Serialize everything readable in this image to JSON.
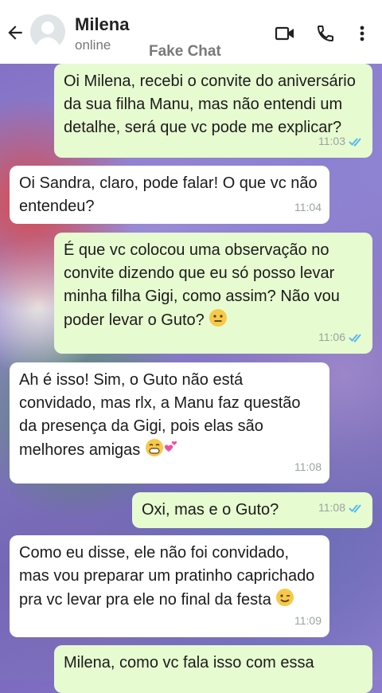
{
  "header": {
    "contact_name": "Milena",
    "status": "online",
    "watermark": "Fake Chat",
    "icons": [
      "back-arrow-icon",
      "avatar",
      "video-call-icon",
      "phone-call-icon",
      "more-options-icon"
    ]
  },
  "colors": {
    "incoming_bubble": "#ffffff",
    "outgoing_bubble": "#e6fbd0",
    "read_ticks": "#4fb6ec"
  },
  "messages": [
    {
      "direction": "out",
      "text": "Oi Milena, recebi o convite do aniversário da sua filha Manu, mas não entendi um detalhe, será que vc pode me explicar?",
      "time": "11:03",
      "read": true
    },
    {
      "direction": "in",
      "text": "Oi Sandra, claro, pode falar! O que vc não entendeu?",
      "time": "11:04"
    },
    {
      "direction": "out",
      "text": "É que vc colocou uma observação no convite dizendo que eu só posso levar minha filha Gigi, como assim? Não vou poder levar o Guto?",
      "emoji": "neutral-face-emoji",
      "time": "11:06",
      "read": true
    },
    {
      "direction": "in",
      "text": "Ah é isso! Sim, o Guto não está convidado, mas rlx, a Manu faz questão da presença da Gigi, pois elas são melhores amigas",
      "emoji": "grin-hearts-emoji",
      "time": "11:08"
    },
    {
      "direction": "out",
      "text": "Oxi, mas e o Guto?",
      "time": "11:08",
      "read": true
    },
    {
      "direction": "in",
      "text": "Como eu disse, ele não foi convidado, mas vou preparar um pratinho caprichado pra vc levar pra ele no final da festa",
      "emoji": "wink-emoji",
      "time": "11:09"
    },
    {
      "direction": "out",
      "text": "Milena, como vc fala isso com  essa",
      "time": ""
    }
  ]
}
